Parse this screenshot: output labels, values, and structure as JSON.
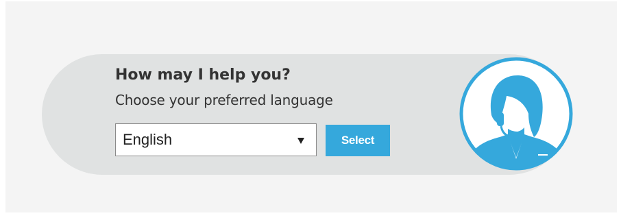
{
  "widget": {
    "headline": "How may I help you?",
    "subline": "Choose your preferred language",
    "language_select": {
      "selected": "English",
      "icon": "chevron-down-icon"
    },
    "select_button_label": "Select",
    "avatar_icon": "support-agent-headset-icon"
  },
  "colors": {
    "page_background": "#f4f4f4",
    "widget_background": "#e0e2e2",
    "accent": "#35a8dc",
    "text": "#333333"
  }
}
